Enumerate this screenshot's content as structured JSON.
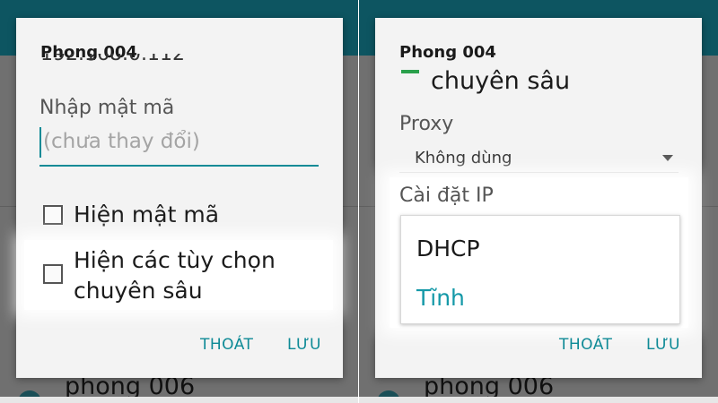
{
  "left_dialog": {
    "title": "Phong 004",
    "clipped_text": "192.168.0.112",
    "password_label": "Nhập mật mã",
    "password_placeholder": "(chưa thay đổi)",
    "show_password": "Hiện mật mã",
    "advanced_line1": "Hiện các tùy chọn",
    "advanced_line2": "chuyên sâu",
    "cancel": "THOÁT",
    "save": "LƯU"
  },
  "right_dialog": {
    "title": "Phong 004",
    "subtitle": "chuyên sâu",
    "proxy_label": "Proxy",
    "proxy_value": "Không dùng",
    "ip_label": "Cài đặt IP",
    "ip_options": [
      "DHCP",
      "Tĩnh"
    ],
    "cancel": "THOÁT",
    "save": "LƯU"
  },
  "background": {
    "network_item": "phong 006"
  },
  "colors": {
    "accent": "#0e8a96",
    "selected_option": "#1599a8",
    "appbar": "#0d5561"
  }
}
